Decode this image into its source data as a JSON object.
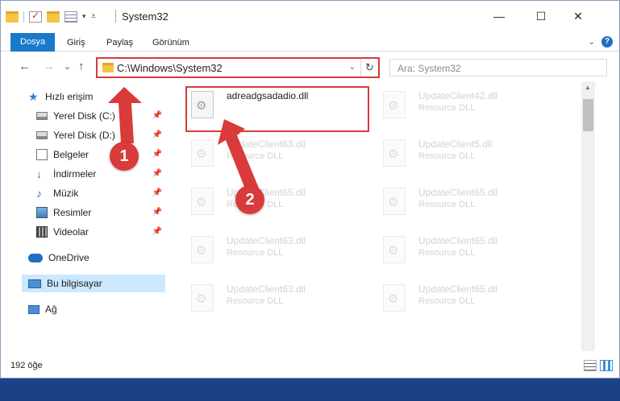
{
  "window": {
    "title": "System32",
    "controls": {
      "minimize": "—",
      "maximize": "☐",
      "close": "✕"
    }
  },
  "ribbon": {
    "tabs": [
      {
        "label": "Dosya",
        "active": true
      },
      {
        "label": "Giriş"
      },
      {
        "label": "Paylaş"
      },
      {
        "label": "Görünüm"
      }
    ],
    "help_label": "?"
  },
  "navigation": {
    "back": "←",
    "forward": "→",
    "recent": "⌄",
    "up": "↑",
    "address_path": "C:\\Windows\\System32",
    "refresh": "↻",
    "search_placeholder": "Ara: System32"
  },
  "sidebar": {
    "items": [
      {
        "label": "Hızlı erişim",
        "icon": "star-icon"
      },
      {
        "label": "Yerel Disk (C:)",
        "icon": "disk-icon",
        "pinned": true
      },
      {
        "label": "Yerel Disk (D:)",
        "icon": "disk-icon",
        "pinned": true
      },
      {
        "label": "Belgeler",
        "icon": "document-icon",
        "pinned": true
      },
      {
        "label": "İndirmeler",
        "icon": "download-icon",
        "pinned": true
      },
      {
        "label": "Müzik",
        "icon": "music-icon",
        "pinned": true
      },
      {
        "label": "Resimler",
        "icon": "pictures-icon",
        "pinned": true
      },
      {
        "label": "Videolar",
        "icon": "video-icon",
        "pinned": true
      },
      {
        "label": "OneDrive",
        "icon": "cloud-icon"
      },
      {
        "label": "Bu bilgisayar",
        "icon": "computer-icon",
        "selected": true
      },
      {
        "label": "Ağ",
        "icon": "network-icon"
      }
    ],
    "pin_glyph": "📌"
  },
  "files": [
    {
      "name": "adreadgsadadio.dll",
      "type": "",
      "highlighted": true
    },
    {
      "name": "UpdateClient42.dll",
      "type": "Resource DLL"
    },
    {
      "name": "UpdateClient63.dll",
      "type": "Resource DLL"
    },
    {
      "name": "UpdateClient5.dll",
      "type": "Resource DLL"
    },
    {
      "name": "UpdateClient65.dll",
      "type": "Resource DLL"
    },
    {
      "name": "UpdateClient65.dll",
      "type": "Resource DLL"
    },
    {
      "name": "UpdateClient63.dll",
      "type": "Resource DLL"
    },
    {
      "name": "UpdateClient65.dll",
      "type": "Resource DLL"
    },
    {
      "name": "UpdateClient63.dll",
      "type": "Resource DLL"
    },
    {
      "name": "UpdateClient65.dll",
      "type": "Resource DLL"
    }
  ],
  "status": {
    "item_count": "192 öğe"
  },
  "callouts": {
    "first": "1",
    "second": "2"
  },
  "colors": {
    "accent": "#1979ca",
    "highlight": "#d93a3a",
    "selection": "#cce8ff"
  }
}
